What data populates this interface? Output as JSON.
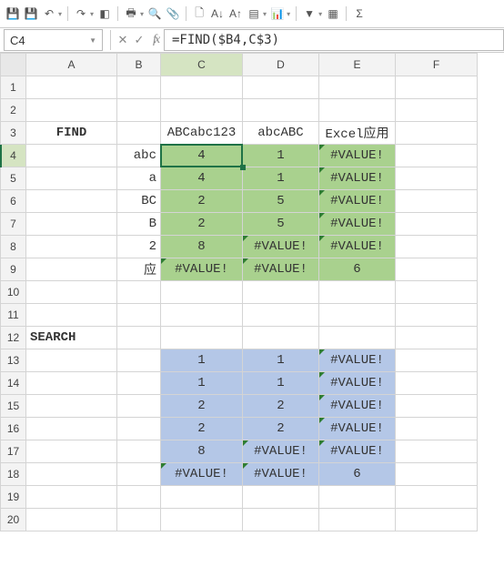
{
  "toolbar_icons": [
    {
      "name": "save-icon",
      "glyph": "💾"
    },
    {
      "name": "save-as-icon",
      "glyph": "💾"
    },
    {
      "name": "undo-icon",
      "glyph": "↶"
    },
    {
      "name": "redo-icon",
      "glyph": "↷"
    },
    {
      "name": "color-icon",
      "glyph": "◧"
    },
    {
      "name": "print-icon",
      "glyph": "🖶"
    },
    {
      "name": "preview-icon",
      "glyph": "🔍"
    },
    {
      "name": "attach-icon",
      "glyph": "📎"
    },
    {
      "name": "newdoc-icon",
      "glyph": "🗋"
    },
    {
      "name": "sort-asc-icon",
      "glyph": "A↓"
    },
    {
      "name": "sort-desc-icon",
      "glyph": "A↑"
    },
    {
      "name": "table-icon",
      "glyph": "▤"
    },
    {
      "name": "chart-icon",
      "glyph": "📊"
    },
    {
      "name": "filter-icon",
      "glyph": "▼"
    },
    {
      "name": "group-icon",
      "glyph": "▦"
    },
    {
      "name": "sum-icon",
      "glyph": "Σ"
    }
  ],
  "namebox": "C4",
  "formula": "=FIND($B4,C$3)",
  "columns": [
    "A",
    "B",
    "C",
    "D",
    "E",
    "F"
  ],
  "row_count": 20,
  "active": {
    "col": "C",
    "row": 4
  },
  "cells": {
    "A3": {
      "v": "FIND",
      "align": "ac",
      "bold": true
    },
    "A12": {
      "v": "SEARCH",
      "align": "al",
      "bold": true
    },
    "B4": {
      "v": "abc",
      "align": "ar"
    },
    "B5": {
      "v": "a",
      "align": "ar"
    },
    "B6": {
      "v": "BC",
      "align": "ar"
    },
    "B7": {
      "v": "B",
      "align": "ar"
    },
    "B8": {
      "v": "2",
      "align": "ar"
    },
    "B9": {
      "v": "应",
      "align": "ar"
    },
    "C3": {
      "v": "ABCabc123",
      "align": "ac"
    },
    "D3": {
      "v": "abcABC",
      "align": "ac"
    },
    "E3": {
      "v": "Excel应用",
      "align": "ac"
    },
    "C4": {
      "v": "4",
      "align": "ac",
      "bg": "green"
    },
    "D4": {
      "v": "1",
      "align": "ac",
      "bg": "green"
    },
    "E4": {
      "v": "#VALUE!",
      "align": "ac",
      "bg": "green",
      "err": true
    },
    "C5": {
      "v": "4",
      "align": "ac",
      "bg": "green"
    },
    "D5": {
      "v": "1",
      "align": "ac",
      "bg": "green"
    },
    "E5": {
      "v": "#VALUE!",
      "align": "ac",
      "bg": "green",
      "err": true
    },
    "C6": {
      "v": "2",
      "align": "ac",
      "bg": "green"
    },
    "D6": {
      "v": "5",
      "align": "ac",
      "bg": "green"
    },
    "E6": {
      "v": "#VALUE!",
      "align": "ac",
      "bg": "green",
      "err": true
    },
    "C7": {
      "v": "2",
      "align": "ac",
      "bg": "green"
    },
    "D7": {
      "v": "5",
      "align": "ac",
      "bg": "green"
    },
    "E7": {
      "v": "#VALUE!",
      "align": "ac",
      "bg": "green",
      "err": true
    },
    "C8": {
      "v": "8",
      "align": "ac",
      "bg": "green"
    },
    "D8": {
      "v": "#VALUE!",
      "align": "ac",
      "bg": "green",
      "err": true
    },
    "E8": {
      "v": "#VALUE!",
      "align": "ac",
      "bg": "green",
      "err": true
    },
    "C9": {
      "v": "#VALUE!",
      "align": "ac",
      "bg": "green",
      "err": true
    },
    "D9": {
      "v": "#VALUE!",
      "align": "ac",
      "bg": "green",
      "err": true
    },
    "E9": {
      "v": "6",
      "align": "ac",
      "bg": "green"
    },
    "C13": {
      "v": "1",
      "align": "ac",
      "bg": "blue"
    },
    "D13": {
      "v": "1",
      "align": "ac",
      "bg": "blue"
    },
    "E13": {
      "v": "#VALUE!",
      "align": "ac",
      "bg": "blue",
      "err": true
    },
    "C14": {
      "v": "1",
      "align": "ac",
      "bg": "blue"
    },
    "D14": {
      "v": "1",
      "align": "ac",
      "bg": "blue"
    },
    "E14": {
      "v": "#VALUE!",
      "align": "ac",
      "bg": "blue",
      "err": true
    },
    "C15": {
      "v": "2",
      "align": "ac",
      "bg": "blue"
    },
    "D15": {
      "v": "2",
      "align": "ac",
      "bg": "blue"
    },
    "E15": {
      "v": "#VALUE!",
      "align": "ac",
      "bg": "blue",
      "err": true
    },
    "C16": {
      "v": "2",
      "align": "ac",
      "bg": "blue"
    },
    "D16": {
      "v": "2",
      "align": "ac",
      "bg": "blue"
    },
    "E16": {
      "v": "#VALUE!",
      "align": "ac",
      "bg": "blue",
      "err": true
    },
    "C17": {
      "v": "8",
      "align": "ac",
      "bg": "blue"
    },
    "D17": {
      "v": "#VALUE!",
      "align": "ac",
      "bg": "blue",
      "err": true
    },
    "E17": {
      "v": "#VALUE!",
      "align": "ac",
      "bg": "blue",
      "err": true
    },
    "C18": {
      "v": "#VALUE!",
      "align": "ac",
      "bg": "blue",
      "err": true
    },
    "D18": {
      "v": "#VALUE!",
      "align": "ac",
      "bg": "blue",
      "err": true
    },
    "E18": {
      "v": "6",
      "align": "ac",
      "bg": "blue"
    }
  }
}
